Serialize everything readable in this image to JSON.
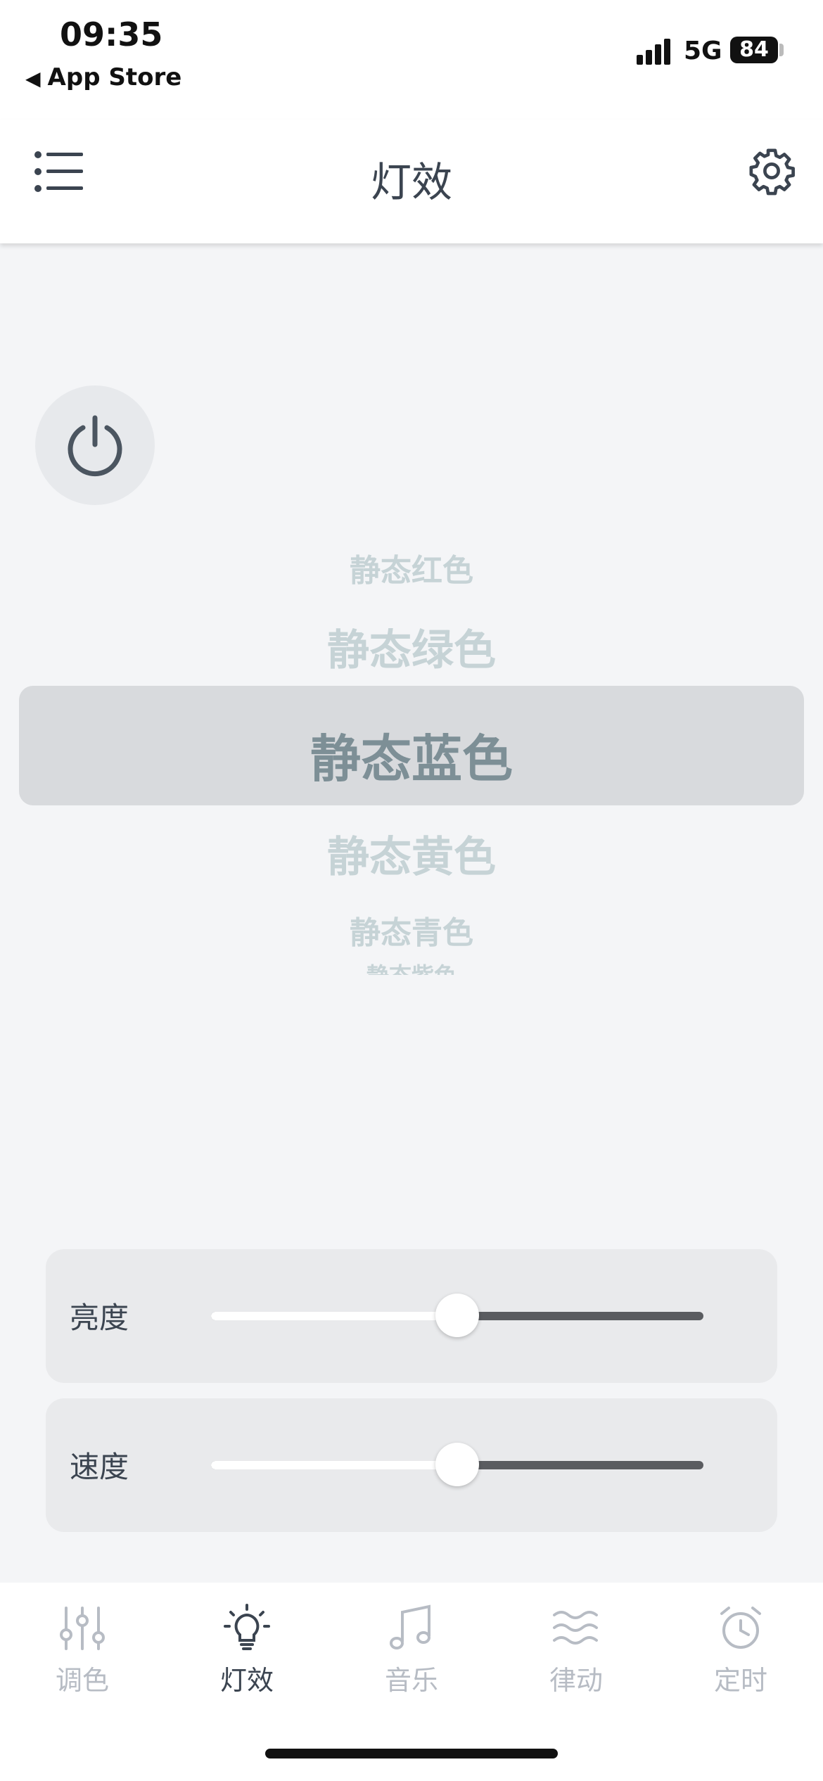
{
  "status_bar": {
    "time": "09:35",
    "back_label": "App Store",
    "network": "5G",
    "battery": "84"
  },
  "nav": {
    "title": "灯效"
  },
  "effects": {
    "items": [
      "静态红色",
      "静态绿色",
      "静态蓝色",
      "静态黄色",
      "静态青色",
      "静态紫色"
    ],
    "selected": "静态蓝色"
  },
  "sliders": {
    "brightness": {
      "label": "亮度",
      "value_fraction": 0.5
    },
    "speed": {
      "label": "速度",
      "value_fraction": 0.5
    }
  },
  "tabs": [
    {
      "label": "调色",
      "icon": "sliders-icon",
      "active": false
    },
    {
      "label": "灯效",
      "icon": "lightbulb-icon",
      "active": true
    },
    {
      "label": "音乐",
      "icon": "music-note-icon",
      "active": false
    },
    {
      "label": "律动",
      "icon": "wave-icon",
      "active": false
    },
    {
      "label": "定时",
      "icon": "alarm-clock-icon",
      "active": false
    }
  ],
  "colors": {
    "active": "#3b4450",
    "inactive": "#b7bcc4",
    "picker_faded": "#c6d3d6",
    "picker_selected": "#7d8f96"
  }
}
